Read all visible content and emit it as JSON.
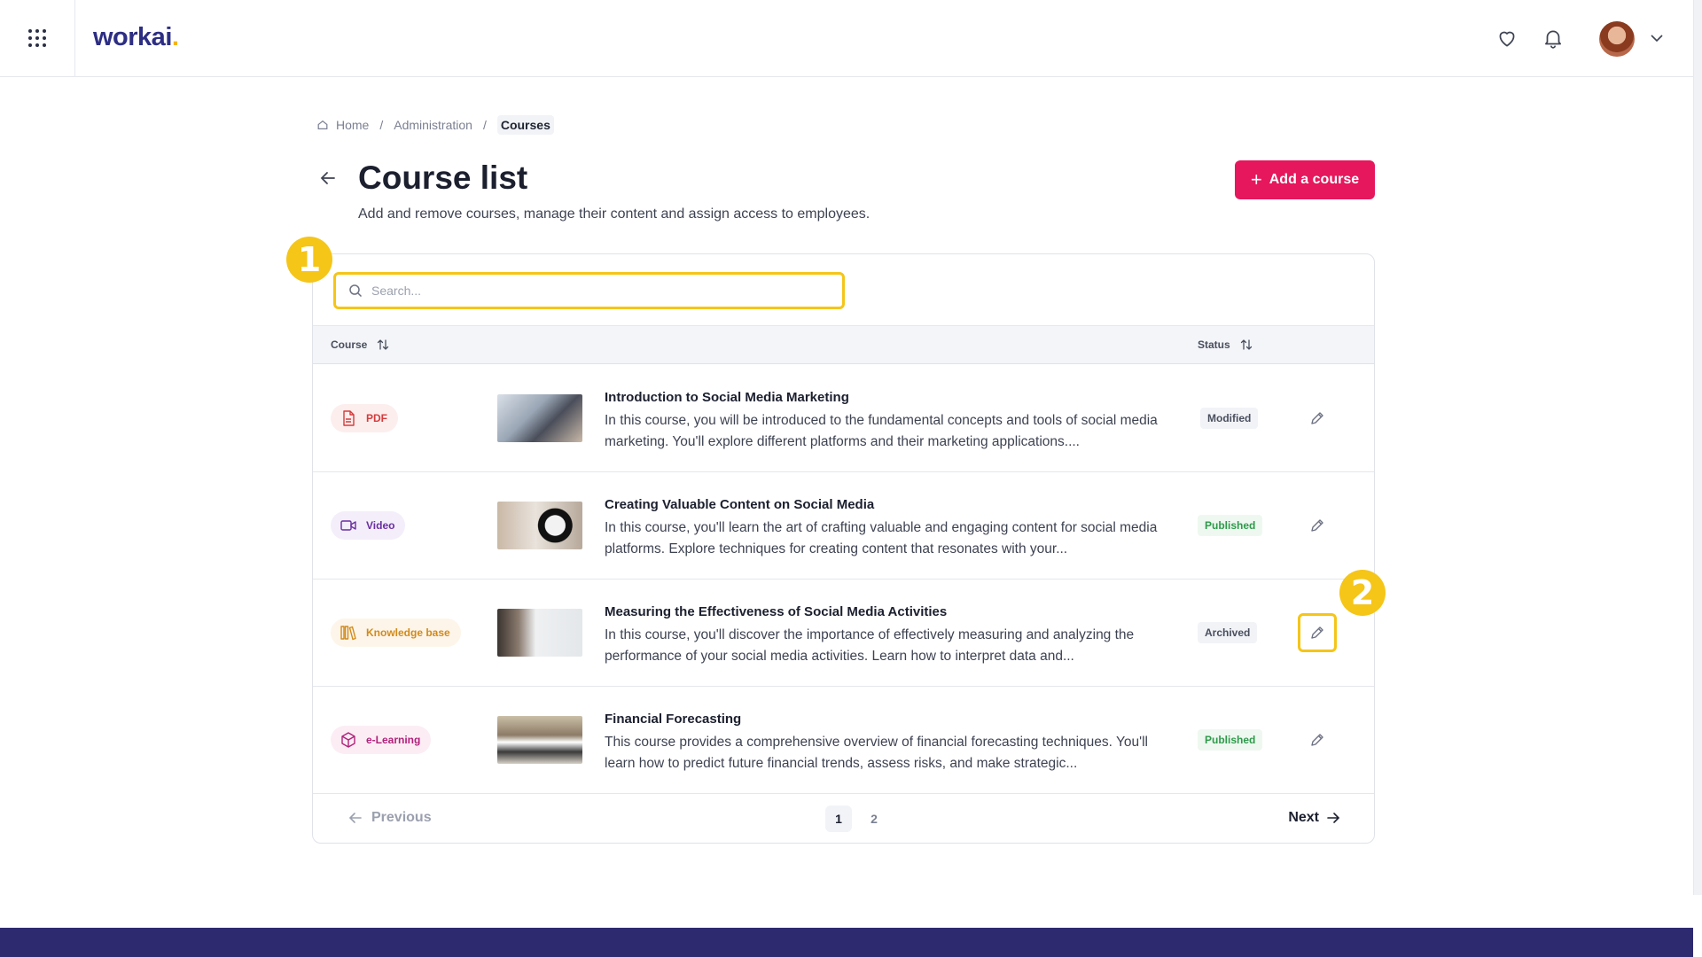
{
  "app": {
    "logo_text": "workai",
    "logo_dot": "."
  },
  "topbar": {
    "icons": [
      "apps-grid-icon",
      "heart-icon",
      "bell-icon",
      "chevron-down-icon"
    ]
  },
  "breadcrumb": {
    "home": "Home",
    "admin": "Administration",
    "current": "Courses",
    "separator": "/"
  },
  "header": {
    "title": "Course list",
    "subtitle": "Add and remove courses, manage their content and assign access to employees.",
    "add_button": "Add a course"
  },
  "search": {
    "placeholder": "Search..."
  },
  "table": {
    "columns": {
      "course": "Course",
      "status": "Status"
    },
    "rows": [
      {
        "type": "PDF",
        "title": "Introduction to Social Media Marketing",
        "description": "In this course, you will be introduced to the fundamental concepts and tools of social media marketing. You'll explore different platforms and their marketing applications....",
        "status": "Modified"
      },
      {
        "type": "Video",
        "title": "Creating Valuable Content on Social Media",
        "description": "In this course, you'll learn the art of crafting valuable and engaging content for social media platforms. Explore techniques for creating content that resonates with your...",
        "status": "Published"
      },
      {
        "type": "Knowledge base",
        "title": "Measuring the Effectiveness of Social Media Activities",
        "description": "In this course, you'll discover the importance of effectively measuring and analyzing the performance of your social media activities. Learn how to interpret data and...",
        "status": "Archived"
      },
      {
        "type": "e-Learning",
        "title": "Financial Forecasting",
        "description": "This course provides a comprehensive overview of financial forecasting techniques. You'll learn how to predict future financial trends, assess risks, and make strategic...",
        "status": "Published"
      }
    ]
  },
  "pagination": {
    "previous": "Previous",
    "next": "Next",
    "pages": [
      "1",
      "2"
    ],
    "current": "1"
  },
  "callouts": {
    "first": "1",
    "second": "2"
  },
  "colors": {
    "brand": "#2d2e83",
    "accent": "#e6175c",
    "highlight": "#f5c518",
    "pdf": "#d63b3b",
    "video": "#6a2fa0",
    "knowledge": "#d28a1a",
    "elearning": "#b0227a",
    "published": "#2e9a4a",
    "modified": "#4a4f5e",
    "archived": "#4a4f5e"
  }
}
